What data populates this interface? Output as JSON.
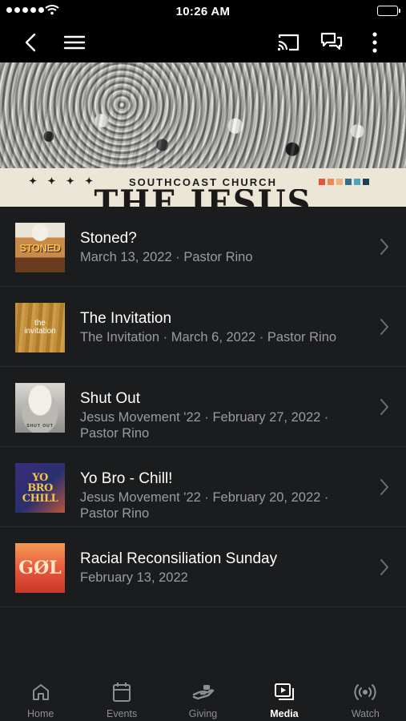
{
  "status_bar": {
    "time": "10:26 AM"
  },
  "nav": {
    "back_icon": "chevron-left-icon",
    "menu_icon": "hamburger-icon",
    "cast_icon": "cast-icon",
    "chat_icon": "chat-icon",
    "more_icon": "more-vertical-icon"
  },
  "banner": {
    "decoration": "✦ ✦ ✦ ✦",
    "church": "SOUTHCOAST CHURCH",
    "headline": "THE JESUS MOVEMENT",
    "swatches": [
      "#e6553a",
      "#f08a4a",
      "#f4b07a",
      "#2d6f8f",
      "#4aa3c0",
      "#1f3d55"
    ]
  },
  "media_items": [
    {
      "title": "Stoned?",
      "subtitle": "March 13, 2022 · Pastor Rino",
      "thumb_text": "STONED"
    },
    {
      "title": "The Invitation",
      "subtitle": "The Invitation · March 6, 2022 · Pastor Rino",
      "thumb_text": "the invitation"
    },
    {
      "title": "Shut Out",
      "subtitle": "Jesus Movement '22 · February 27, 2022 · Pastor Rino",
      "thumb_text": "SHUT OUT"
    },
    {
      "title": "Yo Bro - Chill!",
      "subtitle": "Jesus Movement '22 · February 20, 2022 · Pastor Rino",
      "thumb_text": "YO BRO CHILL"
    },
    {
      "title": "Racial Reconsiliation Sunday",
      "subtitle": "February 13, 2022",
      "thumb_text": "GØL"
    }
  ],
  "tabs": [
    {
      "label": "Home",
      "icon": "home-icon",
      "active": false
    },
    {
      "label": "Events",
      "icon": "calendar-icon",
      "active": false
    },
    {
      "label": "Giving",
      "icon": "giving-hand-icon",
      "active": false
    },
    {
      "label": "Media",
      "icon": "media-play-icon",
      "active": true
    },
    {
      "label": "Watch",
      "icon": "broadcast-icon",
      "active": false
    }
  ],
  "colors": {
    "background": "#1b1c1e",
    "bar": "#000000",
    "text_secondary": "#9a9b9e",
    "tab_inactive": "#8e8f92",
    "divider": "#2a2b2e"
  }
}
